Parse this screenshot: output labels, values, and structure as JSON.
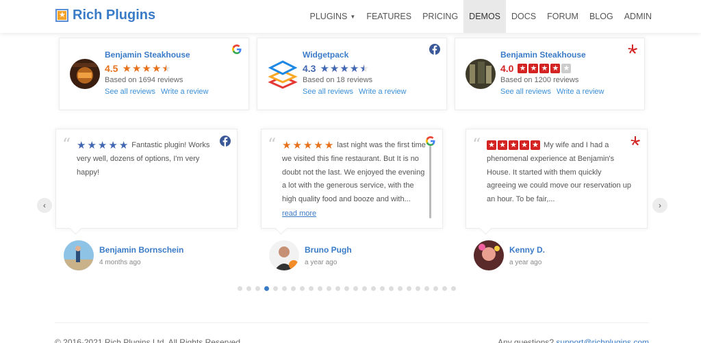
{
  "header": {
    "logo_text": "Rich Plugins",
    "nav": [
      {
        "label": "PLUGINS",
        "dropdown": true,
        "active": false
      },
      {
        "label": "FEATURES",
        "active": false
      },
      {
        "label": "PRICING",
        "active": false
      },
      {
        "label": "DEMOS",
        "active": true
      },
      {
        "label": "DOCS",
        "active": false
      },
      {
        "label": "FORUM",
        "active": false
      },
      {
        "label": "BLOG",
        "active": false
      },
      {
        "label": "ADMIN",
        "active": false
      }
    ]
  },
  "badges": [
    {
      "name": "Benjamin Steakhouse",
      "rating": "4.5",
      "rating_value": 4.5,
      "based": "Based on 1694 reviews",
      "see_all": "See all reviews",
      "write": "Write a review",
      "platform": "google-icon",
      "score_color": "#e7711b"
    },
    {
      "name": "Widgetpack",
      "rating": "4.3",
      "rating_value": 4.3,
      "based": "Based on 18 reviews",
      "see_all": "See all reviews",
      "write": "Write a review",
      "platform": "facebook-icon",
      "score_color": "#4267b2"
    },
    {
      "name": "Benjamin Steakhouse",
      "rating": "4.0",
      "rating_value": 4.0,
      "based": "Based on 1200 reviews",
      "see_all": "See all reviews",
      "write": "Write a review",
      "platform": "yelp-icon",
      "score_color": "#d32323"
    }
  ],
  "reviews": [
    {
      "stars": 5,
      "platform": "facebook-icon",
      "text": "Fantastic plugin! Works very well, dozens of options, I'm very happy!",
      "author": "Benjamin Bornschein",
      "ago": "4 months ago"
    },
    {
      "stars": 5,
      "platform": "google-icon",
      "text": "last night was the first time we visited this fine restaurant. But It is no doubt not the last. We enjoyed the evening a lot with the generous service, with the high quality food and booze and with...",
      "read_more": "read more",
      "author": "Bruno Pugh",
      "ago": "a year ago"
    },
    {
      "stars": 5,
      "platform": "yelp-icon",
      "text": "My wife and I had a phenomenal experience at Benjamin's House. It started with them quickly agreeing we could move our reservation up an hour. To be fair,...",
      "author": "Kenny D.",
      "ago": "a year ago"
    }
  ],
  "slider": {
    "prev": "‹",
    "next": "›",
    "dot_count": 25,
    "active_dot": 4
  },
  "footer": {
    "copyright": "© 2016-2021 Rich Plugins Ltd. All Rights Reserved",
    "questions": "Any questions?",
    "email": "support@richplugins.com"
  },
  "colors": {
    "brand": "#3a7bc8",
    "google_star": "#e7711b",
    "facebook_star": "#4267b2",
    "yelp_red": "#d32323"
  }
}
